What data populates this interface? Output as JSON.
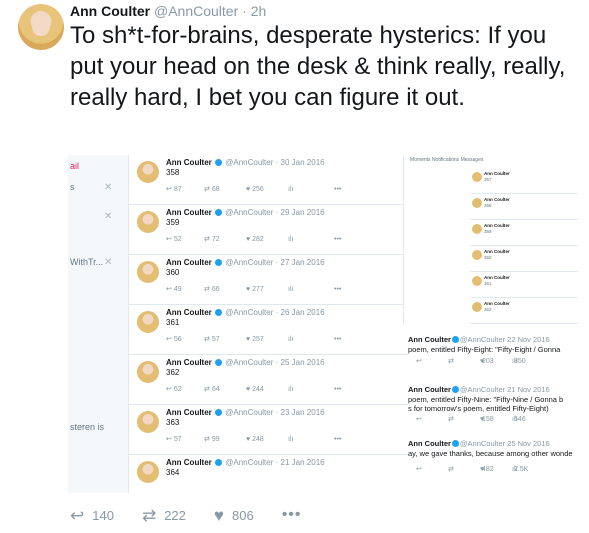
{
  "tweet": {
    "author_name": "Ann Coulter",
    "handle": "@AnnCoulter",
    "separator": "·",
    "time": "2h",
    "text": "To sh*t-for-brains, desperate hysterics: If you put your head on the desk & think really, really, really hard, I bet you can figure it out.",
    "actions": {
      "reply_count": "140",
      "retweet_count": "222",
      "like_count": "806",
      "more": "•••"
    }
  },
  "icons": {
    "reply": "reply-arrow-icon",
    "retweet": "retweet-icon",
    "like": "heart-icon",
    "more": "more-dots-icon",
    "verified": "verified-badge-icon"
  },
  "colors": {
    "text": "#14171a",
    "muted": "#8899a6",
    "verified": "#1da1f2",
    "border": "#e1e8ed"
  },
  "collage": {
    "left_fragments": [
      "ail",
      "s",
      "WithTr...",
      "steren is"
    ],
    "left_x": "✕",
    "mini_tweets": [
      {
        "name": "Ann Coulter",
        "handle": "@AnnCoulter",
        "date": "30 Jan 2016",
        "num": "358",
        "reply": "87",
        "rt": "68",
        "like": "256"
      },
      {
        "name": "Ann Coulter",
        "handle": "@AnnCoulter",
        "date": "29 Jan 2016",
        "num": "359",
        "reply": "52",
        "rt": "72",
        "like": "282"
      },
      {
        "name": "Ann Coulter",
        "handle": "@AnnCoulter",
        "date": "27 Jan 2016",
        "num": "360",
        "reply": "49",
        "rt": "66",
        "like": "277"
      },
      {
        "name": "Ann Coulter",
        "handle": "@AnnCoulter",
        "date": "26 Jan 2016",
        "num": "361",
        "reply": "56",
        "rt": "57",
        "like": "257"
      },
      {
        "name": "Ann Coulter",
        "handle": "@AnnCoulter",
        "date": "25 Jan 2016",
        "num": "362",
        "reply": "62",
        "rt": "64",
        "like": "244"
      },
      {
        "name": "Ann Coulter",
        "handle": "@AnnCoulter",
        "date": "23 Jan 2016",
        "num": "363",
        "reply": "57",
        "rt": "99",
        "like": "248"
      },
      {
        "name": "Ann Coulter",
        "handle": "@AnnCoulter",
        "date": "21 Jan 2016",
        "num": "364",
        "reply": "",
        "rt": "",
        "like": ""
      }
    ],
    "right_top": "Moments   Notifications   Messages",
    "right_items": [
      {
        "num": "357"
      },
      {
        "num": "358"
      },
      {
        "num": "359"
      },
      {
        "num": "360"
      },
      {
        "num": "361"
      },
      {
        "num": "362"
      },
      {
        "num": "363"
      }
    ],
    "lower_tweets": [
      {
        "name": "Ann Coulter",
        "handle": "@AnnCoulter",
        "date": "22 Nov 2016",
        "line1": "poem, entitled Fifty-Eight: \"Fifty-Eight / Gonna",
        "line2": "",
        "reply": "",
        "rt": "203",
        "like": "850"
      },
      {
        "name": "Ann Coulter",
        "handle": "@AnnCoulter",
        "date": "21 Nov 2016",
        "line1": "poem, entitled Fifty-Nine: \"Fifty-Nine / Gonna b",
        "line2": "s for tomorrow's poem, entitled Fifty-Eight)",
        "reply": "",
        "rt": "158",
        "like": "646"
      },
      {
        "name": "Ann Coulter",
        "handle": "@AnnCoulter",
        "date": "25 Nov 2016",
        "line1": "ay, we gave thanks, because among other wonde",
        "line2": "",
        "reply": "",
        "rt": "482",
        "like": "2.5K"
      }
    ]
  }
}
